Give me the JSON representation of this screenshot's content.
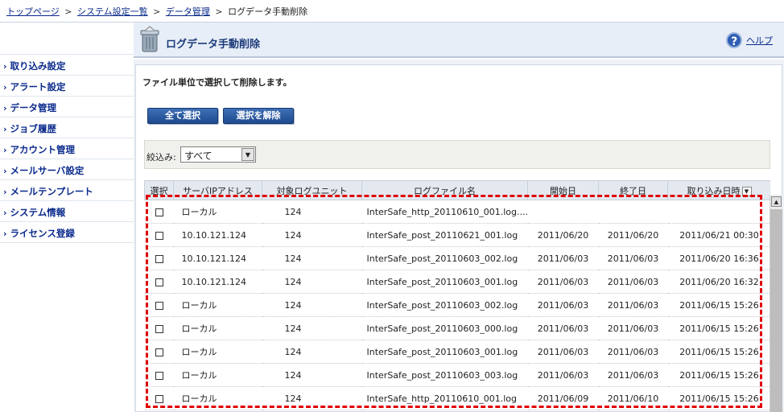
{
  "breadcrumb": {
    "top": "トップページ",
    "system": "システム設定一覧",
    "data": "データ管理",
    "current": "ログデータ手動削除",
    "sep": ">"
  },
  "sidebar": {
    "arrow": "›",
    "items": [
      {
        "label": "取り込み設定"
      },
      {
        "label": "アラート設定"
      },
      {
        "label": "データ管理"
      },
      {
        "label": "ジョブ履歴"
      },
      {
        "label": "アカウント管理"
      },
      {
        "label": "メールサーバ設定"
      },
      {
        "label": "メールテンプレート"
      },
      {
        "label": "システム情報"
      },
      {
        "label": "ライセンス登録"
      }
    ]
  },
  "header": {
    "title": "ログデータ手動削除",
    "help_icon_glyph": "?",
    "help_label": "ヘルプ",
    "icon": "trash-bin-icon"
  },
  "main": {
    "description": "ファイル単位で選択して削除します。",
    "buttons": {
      "select_all": "全て選択",
      "deselect": "選択を解除"
    },
    "filter": {
      "label": "絞込み:",
      "selected": "すべて",
      "dropdown_glyph": "▼"
    }
  },
  "table": {
    "headers": {
      "select": "選択",
      "ip": "サーバIPアドレス",
      "unit": "対象ログユニット",
      "file": "ログファイル名",
      "start": "開始日",
      "end": "終了日",
      "imported": "取り込み日時"
    },
    "sort_glyph": "▼",
    "rows": [
      {
        "ip": "ローカル",
        "unit": "124",
        "file": "InterSafe_http_20110610_001.log....",
        "start": "",
        "end": "",
        "imported": ""
      },
      {
        "ip": "10.10.121.124",
        "unit": "124",
        "file": "InterSafe_post_20110621_001.log",
        "start": "2011/06/20",
        "end": "2011/06/20",
        "imported": "2011/06/21 00:30"
      },
      {
        "ip": "10.10.121.124",
        "unit": "124",
        "file": "InterSafe_post_20110603_002.log",
        "start": "2011/06/03",
        "end": "2011/06/03",
        "imported": "2011/06/20 16:36"
      },
      {
        "ip": "10.10.121.124",
        "unit": "124",
        "file": "InterSafe_post_20110603_001.log",
        "start": "2011/06/03",
        "end": "2011/06/03",
        "imported": "2011/06/20 16:32"
      },
      {
        "ip": "ローカル",
        "unit": "124",
        "file": "InterSafe_post_20110603_002.log",
        "start": "2011/06/03",
        "end": "2011/06/03",
        "imported": "2011/06/15 15:26"
      },
      {
        "ip": "ローカル",
        "unit": "124",
        "file": "InterSafe_post_20110603_000.log",
        "start": "2011/06/03",
        "end": "2011/06/03",
        "imported": "2011/06/15 15:26"
      },
      {
        "ip": "ローカル",
        "unit": "124",
        "file": "InterSafe_post_20110603_001.log",
        "start": "2011/06/03",
        "end": "2011/06/03",
        "imported": "2011/06/15 15:26"
      },
      {
        "ip": "ローカル",
        "unit": "124",
        "file": "InterSafe_post_20110603_003.log",
        "start": "2011/06/03",
        "end": "2011/06/03",
        "imported": "2011/06/15 15:26"
      },
      {
        "ip": "ローカル",
        "unit": "124",
        "file": "InterSafe_http_20110610_001.log",
        "start": "2011/06/09",
        "end": "2011/06/10",
        "imported": "2011/06/15 15:26"
      }
    ]
  },
  "scrollbar": {
    "up_glyph": "▲"
  },
  "colors": {
    "link": "#0a2a8c",
    "button": "#1f4a8e",
    "highlight": "#e00000",
    "header_bg": "#e7eef7"
  }
}
